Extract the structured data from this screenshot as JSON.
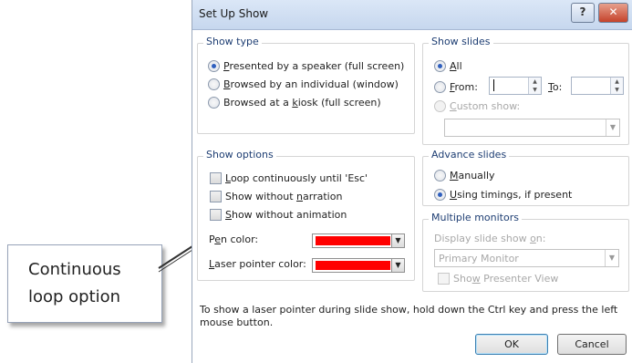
{
  "dialog": {
    "title": "Set Up Show",
    "help_label": "?",
    "close_label": "✕"
  },
  "show_type": {
    "label": "Show type",
    "options": [
      {
        "prefix": "",
        "key": "P",
        "rest": "resented by a speaker (full screen)",
        "selected": true
      },
      {
        "prefix": "",
        "key": "B",
        "rest": "rowsed by an individual (window)",
        "selected": false
      },
      {
        "prefix": "Browsed at a ",
        "key": "k",
        "rest": "iosk (full screen)",
        "selected": false
      }
    ]
  },
  "show_slides": {
    "label": "Show slides",
    "all": {
      "key": "A",
      "rest": "ll",
      "selected": true
    },
    "from": {
      "key": "F",
      "rest": "rom:",
      "value": ""
    },
    "to": {
      "key": "T",
      "rest": "o:",
      "value": ""
    },
    "custom": {
      "key": "C",
      "rest": "ustom show:",
      "value": ""
    }
  },
  "show_options": {
    "label": "Show options",
    "items": [
      {
        "prefix": "",
        "key": "L",
        "rest": "oop continuously until 'Esc'",
        "checked": false
      },
      {
        "prefix": "Show without ",
        "key": "n",
        "rest": "arration",
        "checked": false
      },
      {
        "prefix": "",
        "key": "S",
        "rest": "how without animation",
        "checked": false
      }
    ],
    "pen_color": {
      "prefix": "P",
      "key": "e",
      "rest": "n color:",
      "color": "#ff0000"
    },
    "laser_color": {
      "prefix": "",
      "key": "L",
      "rest": "aser pointer color:",
      "color": "#ff0000"
    }
  },
  "advance_slides": {
    "label": "Advance slides",
    "manually": {
      "key": "M",
      "rest": "anually",
      "selected": false
    },
    "timings": {
      "key": "U",
      "rest": "sing timings, if present",
      "selected": true
    }
  },
  "multiple_monitors": {
    "label": "Multiple monitors",
    "display_on": {
      "prefix": "Display slide show ",
      "key": "o",
      "rest": "n:"
    },
    "monitor_value": "Primary Monitor",
    "presenter": {
      "prefix": "Sho",
      "key": "w",
      "rest": " Presenter View",
      "checked": false
    }
  },
  "footer_note": "To show a laser pointer during slide show, hold down the Ctrl key and press the left mouse button.",
  "buttons": {
    "ok": "OK",
    "cancel": "Cancel"
  },
  "callout": {
    "line1": "Continuous",
    "line2": "loop option"
  }
}
